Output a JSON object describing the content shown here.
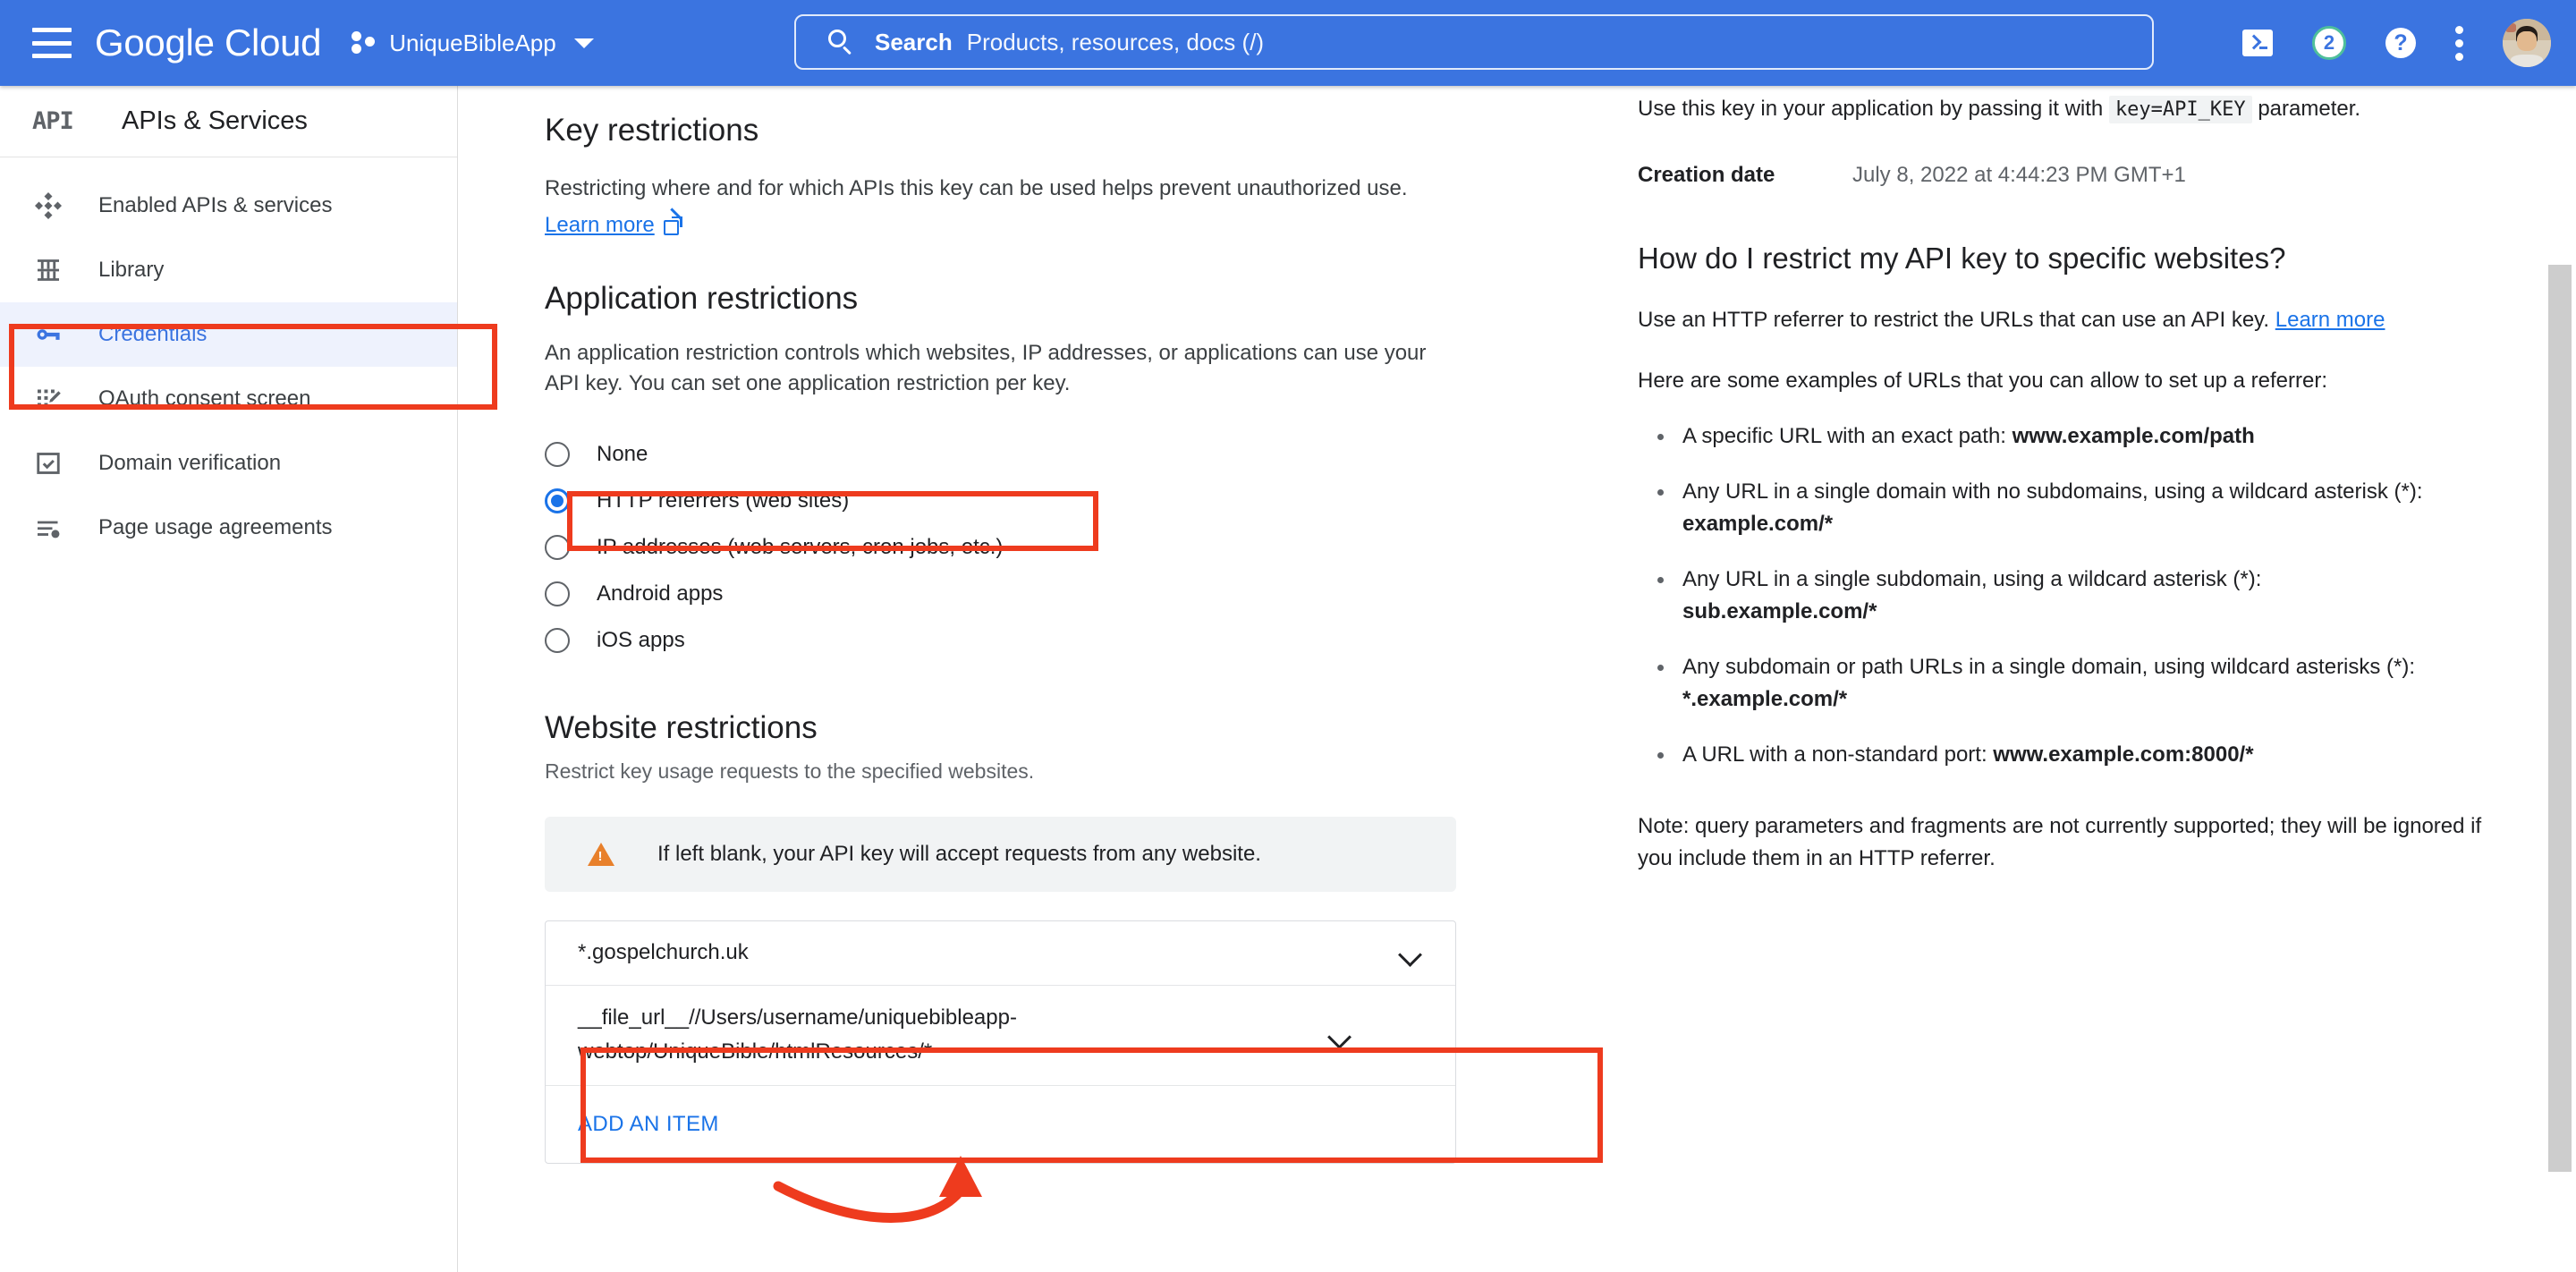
{
  "topbar": {
    "menu_icon": "hamburger-icon",
    "logo_text": "Google Cloud",
    "project_name": "UniqueBibleApp",
    "project_caret": "chevron-down-icon",
    "search": {
      "icon": "search-icon",
      "label": "Search",
      "placeholder": "Products, resources, docs (/)"
    },
    "actions": {
      "terminal_icon": "cloud-shell-terminal-icon",
      "notification_count": "2",
      "help_icon": "help-question-icon",
      "kebab_icon": "more-vertical-icon",
      "avatar": "user-avatar"
    }
  },
  "sidebar": {
    "product_glyph": "API",
    "title": "APIs & Services",
    "items": [
      {
        "label": "Enabled APIs & services",
        "icon": "enabled-apis-icon",
        "active": false
      },
      {
        "label": "Library",
        "icon": "library-icon",
        "active": false
      },
      {
        "label": "Credentials",
        "icon": "key-icon",
        "active": true
      },
      {
        "label": "OAuth consent screen",
        "icon": "oauth-consent-icon",
        "active": false
      },
      {
        "label": "Domain verification",
        "icon": "domain-verification-icon",
        "active": false
      },
      {
        "label": "Page usage agreements",
        "icon": "page-usage-agreements-icon",
        "active": false
      }
    ]
  },
  "main": {
    "key_restrictions": {
      "heading": "Key restrictions",
      "description": "Restricting where and for which APIs this key can be used helps prevent unauthorized use.",
      "learn_more": "Learn more",
      "learn_more_icon": "open-in-new-icon"
    },
    "application_restrictions": {
      "heading": "Application restrictions",
      "description": "An application restriction controls which websites, IP addresses, or applications can use your API key. You can set one application restriction per key.",
      "selected": "HTTP referrers (web sites)",
      "options": [
        {
          "label": "None",
          "checked": false
        },
        {
          "label": "HTTP referrers (web sites)",
          "checked": true
        },
        {
          "label": "IP addresses (web servers, cron jobs, etc.)",
          "checked": false
        },
        {
          "label": "Android apps",
          "checked": false
        },
        {
          "label": "iOS apps",
          "checked": false
        }
      ]
    },
    "website_restrictions": {
      "heading": "Website restrictions",
      "subtext": "Restrict key usage requests to the specified websites.",
      "warning_icon": "warning-triangle-icon",
      "warning_text": "If left blank, your API key will accept requests from any website.",
      "items": [
        {
          "value": "*.gospelchurch.uk",
          "chevron": "chevron-down-icon"
        },
        {
          "value": "__file_url__//Users/username/uniquebibleapp-webtop/UniqueBible/htmlResources/*",
          "chevron": "chevron-down-icon"
        }
      ],
      "add_item_label": "ADD AN ITEM"
    }
  },
  "right_panel": {
    "usage_note_before": "Use this key in your application by passing it with",
    "usage_code": "key=API_KEY",
    "usage_note_after": "parameter.",
    "creation_date_label": "Creation date",
    "creation_date_value": "July 8, 2022 at 4:44:23 PM GMT+1",
    "faq_heading": "How do I restrict my API key to specific websites?",
    "faq_intro_text": "Use an HTTP referrer to restrict the URLs that can use an API key.",
    "faq_intro_link": "Learn more",
    "examples_intro": "Here are some examples of URLs that you can allow to set up a referrer:",
    "examples": [
      {
        "text": "A specific URL with an exact path: ",
        "code": "www.example.com/path",
        "inline": true
      },
      {
        "text": "Any URL in a single domain with no subdomains, using a wildcard asterisk (*): ",
        "code": "example.com/*",
        "inline": false
      },
      {
        "text": "Any URL in a single subdomain, using a wildcard asterisk (*): ",
        "code": "sub.example.com/*",
        "inline": false
      },
      {
        "text": "Any subdomain or path URLs in a single domain, using wildcard asterisks (*): ",
        "code": "*.example.com/*",
        "inline": false
      },
      {
        "text": "A URL with a non-standard port: ",
        "code": "www.example.com:8000/*",
        "inline": true
      }
    ],
    "note": "Note: query parameters and fragments are not currently supported; they will be ignored if you include them in an HTTP referrer."
  },
  "annotations": {
    "color": "#EE3B1E",
    "boxes": [
      "credentials-sidebar-item",
      "http-referrers-radio",
      "file-url-restriction-row"
    ],
    "arrow": "points-from-add-an-item-to-file-url-row"
  },
  "colors": {
    "brand_blue": "#3B74E0",
    "link_blue": "#1a73e8",
    "active_bg": "#eef2fd",
    "annotation_red": "#EE3B1E",
    "warning_orange": "#E8802B",
    "badge_green": "#4FBF9B"
  }
}
